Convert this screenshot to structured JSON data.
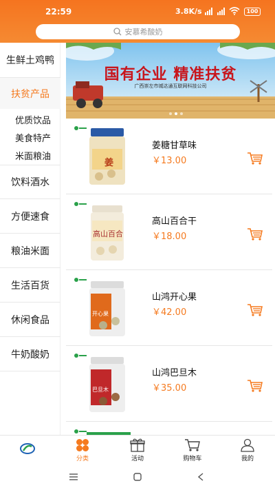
{
  "status": {
    "time": "22:59",
    "speed": "3.8K/s",
    "battery": "100"
  },
  "search": {
    "placeholder": "安慕希酸奶"
  },
  "sidebar": {
    "categories": [
      "生鲜土鸡鸭",
      "扶贫产品",
      "饮料酒水",
      "方便速食",
      "粮油米面",
      "生活百货",
      "休闲食品",
      "牛奶酸奶"
    ],
    "active": "扶贫产品",
    "subcategories": [
      "优质饮品",
      "美食特产",
      "米面粮油"
    ]
  },
  "banner": {
    "headline": "国有企业 精准扶贫",
    "company": "广西崇左市城达通互联网科技公司"
  },
  "products": [
    {
      "name": "姜糖甘草味",
      "price": "￥13.00",
      "jar_label": "姜"
    },
    {
      "name": "高山百合干",
      "price": "￥18.00",
      "jar_label": "高山百合"
    },
    {
      "name": "山鸿开心果",
      "price": "￥42.00",
      "jar_label": "开心果"
    },
    {
      "name": "山鸿巴旦木",
      "price": "￥35.00",
      "jar_label": "巴旦木"
    }
  ],
  "bottom_nav": {
    "items": [
      {
        "label": "",
        "icon": "app-logo-icon"
      },
      {
        "label": "分类",
        "icon": "category-icon",
        "active": true
      },
      {
        "label": "活动",
        "icon": "gift-icon"
      },
      {
        "label": "购物车",
        "icon": "cart-icon"
      },
      {
        "label": "我的",
        "icon": "user-icon"
      }
    ]
  },
  "colors": {
    "accent": "#f57a1f",
    "header": "#f5741f"
  }
}
